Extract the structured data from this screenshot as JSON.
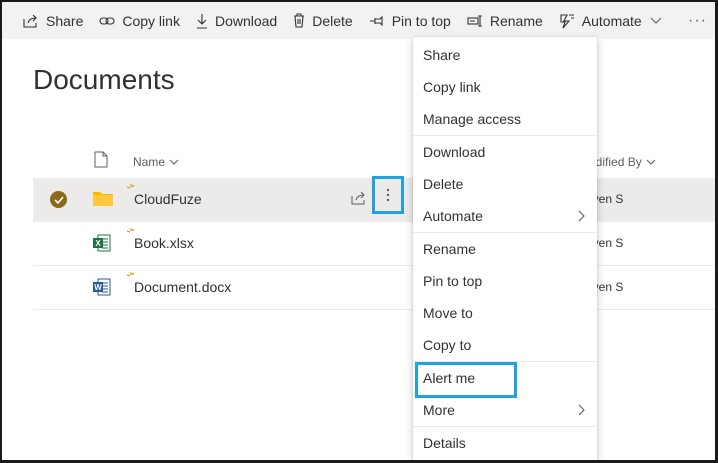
{
  "toolbar": {
    "share": "Share",
    "copy_link": "Copy link",
    "download": "Download",
    "delete": "Delete",
    "pin_to_top": "Pin to top",
    "rename": "Rename",
    "automate": "Automate",
    "more": "···"
  },
  "page": {
    "title": "Documents"
  },
  "table": {
    "headers": {
      "name": "Name",
      "modified_by": "odified By"
    },
    "rows": [
      {
        "name": "CloudFuze",
        "type": "folder",
        "modified_by": "even S",
        "selected": true
      },
      {
        "name": "Book.xlsx",
        "type": "excel",
        "modified_by": "even S",
        "selected": false
      },
      {
        "name": "Document.docx",
        "type": "word",
        "modified_by": "even S",
        "selected": false
      }
    ]
  },
  "context_menu": {
    "items": [
      "Share",
      "Copy link",
      "Manage access",
      "Download",
      "Delete",
      "Automate",
      "Rename",
      "Pin to top",
      "Move to",
      "Copy to",
      "Alert me",
      "More",
      "Details"
    ],
    "highlighted": "Alert me"
  },
  "colors": {
    "highlight_border": "#1ea2e0",
    "check_fill": "#8a6b19",
    "folder": "#ffb900",
    "excel": "#217346",
    "word": "#2b579a",
    "sparkle": "#c19c00"
  }
}
